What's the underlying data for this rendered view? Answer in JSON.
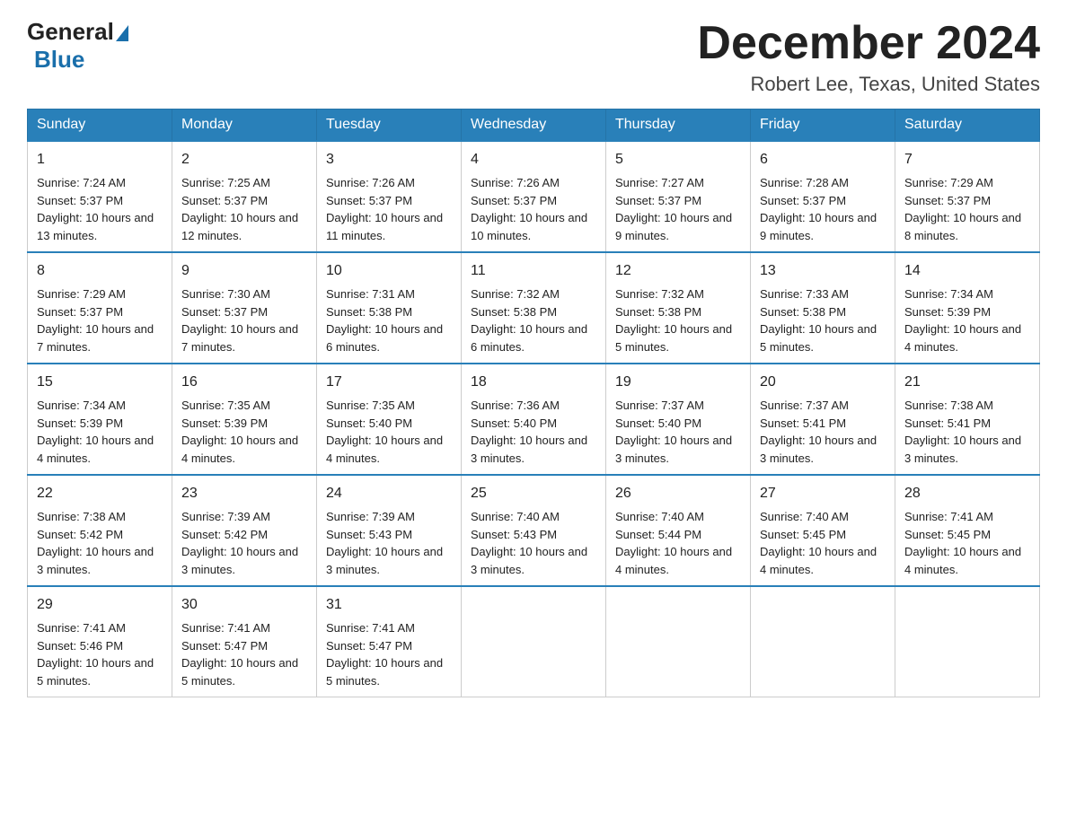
{
  "logo": {
    "general": "General",
    "blue": "Blue"
  },
  "header": {
    "month": "December 2024",
    "location": "Robert Lee, Texas, United States"
  },
  "days_of_week": [
    "Sunday",
    "Monday",
    "Tuesday",
    "Wednesday",
    "Thursday",
    "Friday",
    "Saturday"
  ],
  "weeks": [
    [
      {
        "day": "1",
        "sunrise": "7:24 AM",
        "sunset": "5:37 PM",
        "daylight": "10 hours and 13 minutes."
      },
      {
        "day": "2",
        "sunrise": "7:25 AM",
        "sunset": "5:37 PM",
        "daylight": "10 hours and 12 minutes."
      },
      {
        "day": "3",
        "sunrise": "7:26 AM",
        "sunset": "5:37 PM",
        "daylight": "10 hours and 11 minutes."
      },
      {
        "day": "4",
        "sunrise": "7:26 AM",
        "sunset": "5:37 PM",
        "daylight": "10 hours and 10 minutes."
      },
      {
        "day": "5",
        "sunrise": "7:27 AM",
        "sunset": "5:37 PM",
        "daylight": "10 hours and 9 minutes."
      },
      {
        "day": "6",
        "sunrise": "7:28 AM",
        "sunset": "5:37 PM",
        "daylight": "10 hours and 9 minutes."
      },
      {
        "day": "7",
        "sunrise": "7:29 AM",
        "sunset": "5:37 PM",
        "daylight": "10 hours and 8 minutes."
      }
    ],
    [
      {
        "day": "8",
        "sunrise": "7:29 AM",
        "sunset": "5:37 PM",
        "daylight": "10 hours and 7 minutes."
      },
      {
        "day": "9",
        "sunrise": "7:30 AM",
        "sunset": "5:37 PM",
        "daylight": "10 hours and 7 minutes."
      },
      {
        "day": "10",
        "sunrise": "7:31 AM",
        "sunset": "5:38 PM",
        "daylight": "10 hours and 6 minutes."
      },
      {
        "day": "11",
        "sunrise": "7:32 AM",
        "sunset": "5:38 PM",
        "daylight": "10 hours and 6 minutes."
      },
      {
        "day": "12",
        "sunrise": "7:32 AM",
        "sunset": "5:38 PM",
        "daylight": "10 hours and 5 minutes."
      },
      {
        "day": "13",
        "sunrise": "7:33 AM",
        "sunset": "5:38 PM",
        "daylight": "10 hours and 5 minutes."
      },
      {
        "day": "14",
        "sunrise": "7:34 AM",
        "sunset": "5:39 PM",
        "daylight": "10 hours and 4 minutes."
      }
    ],
    [
      {
        "day": "15",
        "sunrise": "7:34 AM",
        "sunset": "5:39 PM",
        "daylight": "10 hours and 4 minutes."
      },
      {
        "day": "16",
        "sunrise": "7:35 AM",
        "sunset": "5:39 PM",
        "daylight": "10 hours and 4 minutes."
      },
      {
        "day": "17",
        "sunrise": "7:35 AM",
        "sunset": "5:40 PM",
        "daylight": "10 hours and 4 minutes."
      },
      {
        "day": "18",
        "sunrise": "7:36 AM",
        "sunset": "5:40 PM",
        "daylight": "10 hours and 3 minutes."
      },
      {
        "day": "19",
        "sunrise": "7:37 AM",
        "sunset": "5:40 PM",
        "daylight": "10 hours and 3 minutes."
      },
      {
        "day": "20",
        "sunrise": "7:37 AM",
        "sunset": "5:41 PM",
        "daylight": "10 hours and 3 minutes."
      },
      {
        "day": "21",
        "sunrise": "7:38 AM",
        "sunset": "5:41 PM",
        "daylight": "10 hours and 3 minutes."
      }
    ],
    [
      {
        "day": "22",
        "sunrise": "7:38 AM",
        "sunset": "5:42 PM",
        "daylight": "10 hours and 3 minutes."
      },
      {
        "day": "23",
        "sunrise": "7:39 AM",
        "sunset": "5:42 PM",
        "daylight": "10 hours and 3 minutes."
      },
      {
        "day": "24",
        "sunrise": "7:39 AM",
        "sunset": "5:43 PM",
        "daylight": "10 hours and 3 minutes."
      },
      {
        "day": "25",
        "sunrise": "7:40 AM",
        "sunset": "5:43 PM",
        "daylight": "10 hours and 3 minutes."
      },
      {
        "day": "26",
        "sunrise": "7:40 AM",
        "sunset": "5:44 PM",
        "daylight": "10 hours and 4 minutes."
      },
      {
        "day": "27",
        "sunrise": "7:40 AM",
        "sunset": "5:45 PM",
        "daylight": "10 hours and 4 minutes."
      },
      {
        "day": "28",
        "sunrise": "7:41 AM",
        "sunset": "5:45 PM",
        "daylight": "10 hours and 4 minutes."
      }
    ],
    [
      {
        "day": "29",
        "sunrise": "7:41 AM",
        "sunset": "5:46 PM",
        "daylight": "10 hours and 5 minutes."
      },
      {
        "day": "30",
        "sunrise": "7:41 AM",
        "sunset": "5:47 PM",
        "daylight": "10 hours and 5 minutes."
      },
      {
        "day": "31",
        "sunrise": "7:41 AM",
        "sunset": "5:47 PM",
        "daylight": "10 hours and 5 minutes."
      },
      null,
      null,
      null,
      null
    ]
  ],
  "labels": {
    "sunrise": "Sunrise:",
    "sunset": "Sunset:",
    "daylight": "Daylight:"
  }
}
